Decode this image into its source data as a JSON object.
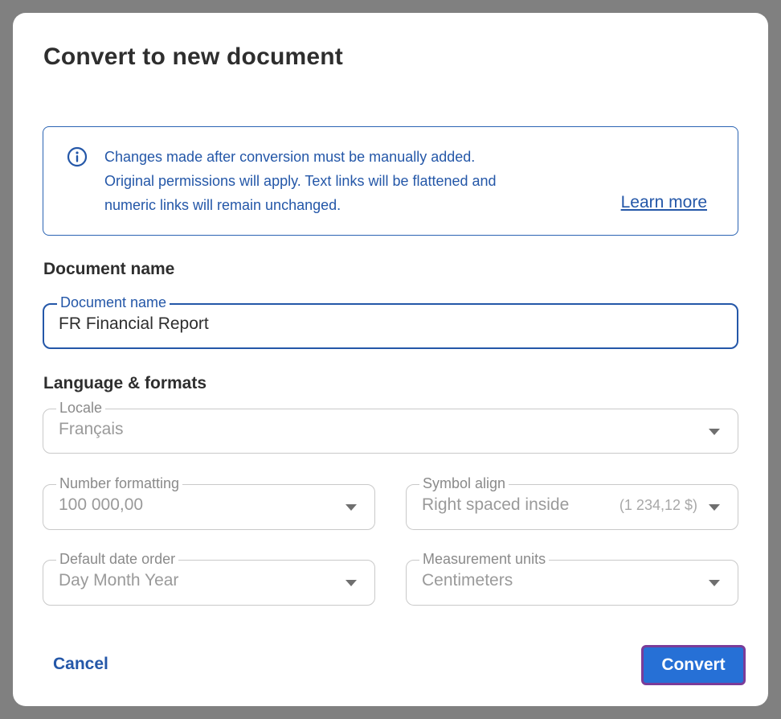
{
  "dialog": {
    "title": "Convert to new document"
  },
  "info": {
    "lines": [
      "Changes made after conversion must be manually added.",
      "Original permissions will apply. Text links will be flattened and",
      "numeric links will remain unchanged."
    ],
    "learn_more": "Learn more",
    "icon": "info-circle-icon",
    "accent_color": "#2457a8"
  },
  "document_section": {
    "heading": "Document name",
    "name_field": {
      "label": "Document name",
      "value": "FR Financial Report"
    }
  },
  "formats_section": {
    "heading": "Language & formats",
    "locale": {
      "label": "Locale",
      "value": "Français"
    },
    "number_formatting": {
      "label": "Number formatting",
      "value": "100 000,00"
    },
    "symbol_align": {
      "label": "Symbol align",
      "value": "Right spaced inside",
      "hint": "(1 234,12 $)"
    },
    "date_order": {
      "label": "Default date order",
      "value": "Day Month Year"
    },
    "measurement_units": {
      "label": "Measurement units",
      "value": "Centimeters"
    }
  },
  "footer": {
    "cancel_label": "Cancel",
    "convert_label": "Convert",
    "convert_color": "#2670d6",
    "focus_ring_color": "#7a3c99"
  }
}
